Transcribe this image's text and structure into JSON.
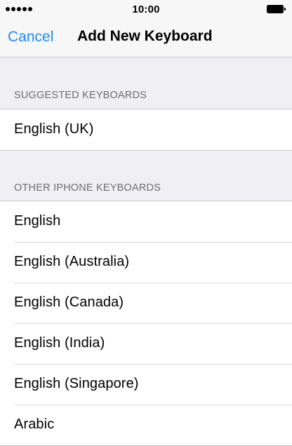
{
  "status_bar": {
    "time": "10:00",
    "signal_icon": "signal-dots-icon",
    "battery_icon": "battery-full-icon"
  },
  "nav": {
    "cancel_label": "Cancel",
    "title": "Add New Keyboard",
    "accent_color": "#1a8cff"
  },
  "sections": {
    "suggested": {
      "header": "SUGGESTED KEYBOARDS",
      "items": [
        "English (UK)"
      ]
    },
    "other": {
      "header": "OTHER IPHONE KEYBOARDS",
      "items": [
        "English",
        "English (Australia)",
        "English (Canada)",
        "English (India)",
        "English (Singapore)",
        "Arabic"
      ]
    }
  }
}
